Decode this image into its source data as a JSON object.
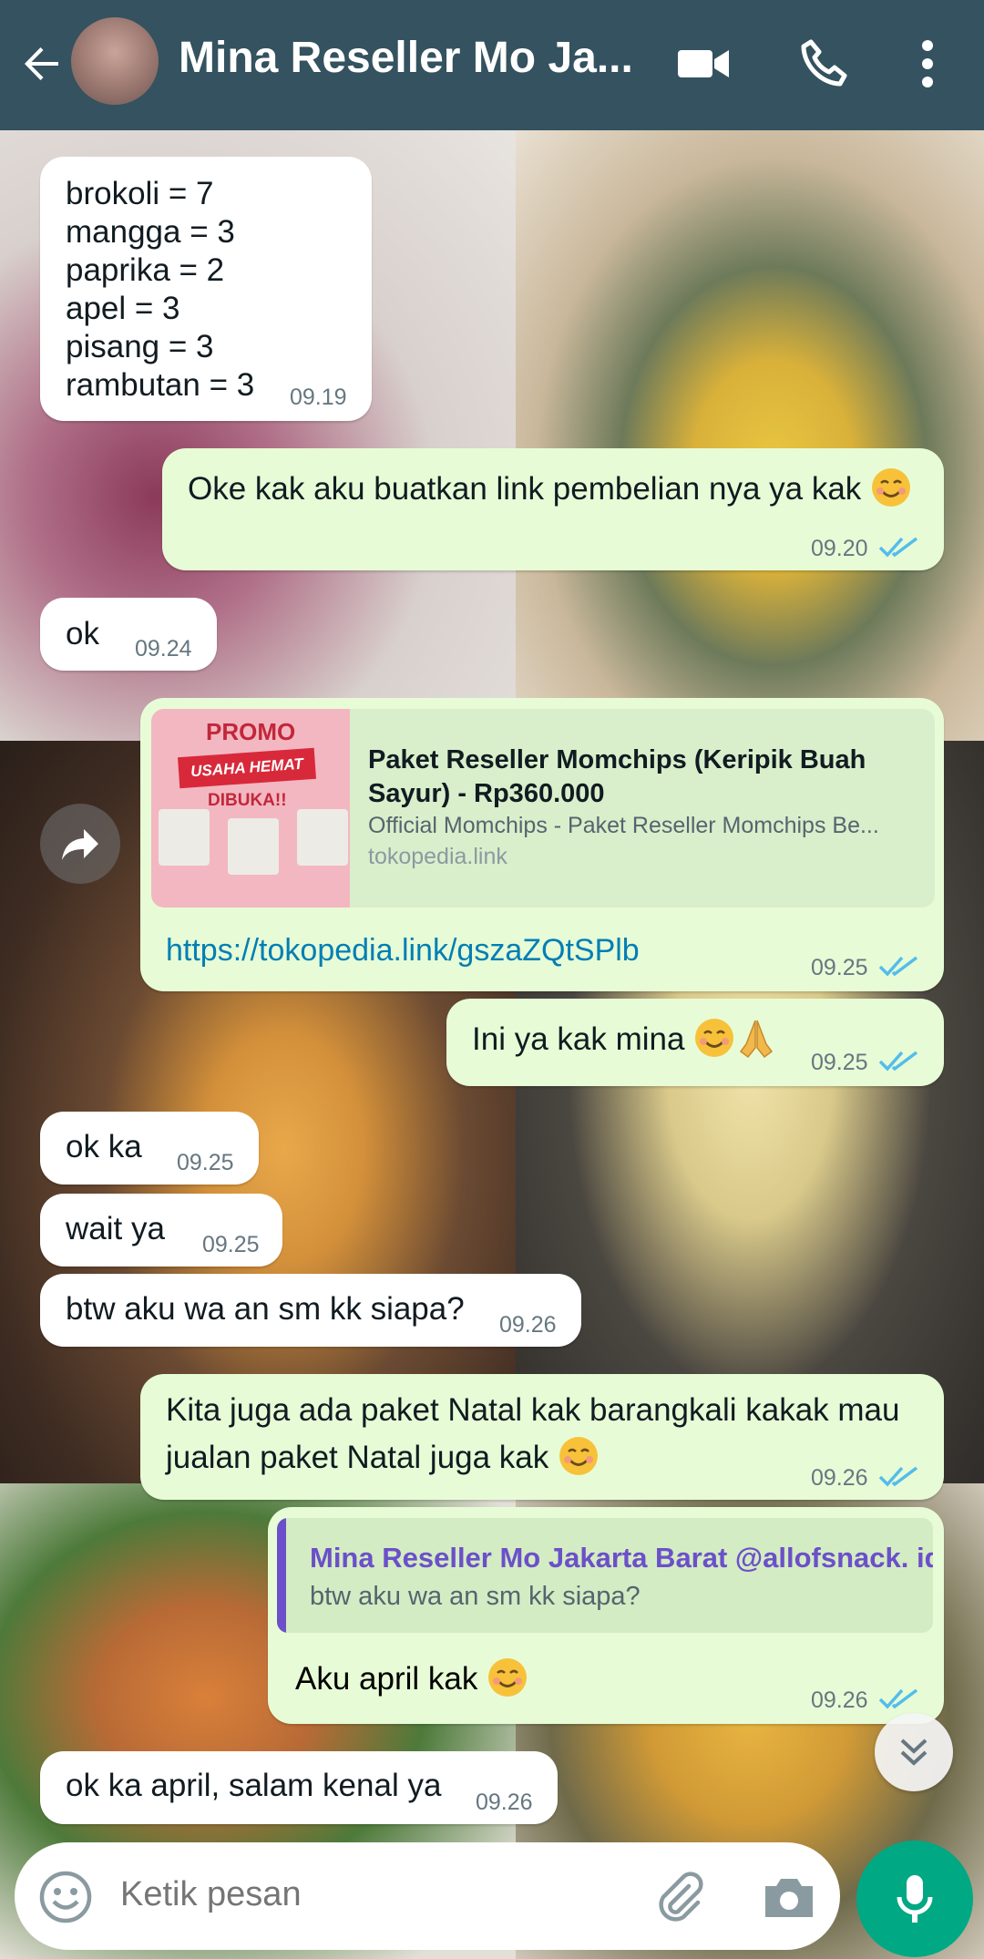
{
  "header": {
    "contact_name": "Mina Reseller Mo Ja...",
    "icons": [
      "arrow-back-icon",
      "video-call-icon",
      "phone-icon",
      "more-vert-icon"
    ]
  },
  "messages": [
    {
      "dir": "in",
      "lines": [
        "brokoli = 7",
        "mangga = 3",
        "paprika = 2",
        "apel = 3",
        "pisang = 3",
        "rambutan = 3"
      ],
      "time": "09.19"
    },
    {
      "dir": "out",
      "text": "Oke kak aku buatkan link pembelian nya ya kak",
      "emoji": "smiling-face-icon",
      "time": "09.20",
      "read": true
    },
    {
      "dir": "in",
      "text": "ok",
      "time": "09.24"
    },
    {
      "dir": "out",
      "preview": {
        "image_label_promo": "PROMO",
        "image_label_banner": "USAHA HEMAT",
        "image_label_open": "DIBUKA!!",
        "title": "Paket Reseller Momchips (Keripik Buah Sayur) - Rp360.000",
        "description": "Official Momchips - Paket Reseller Momchips Be...",
        "domain": "tokopedia.link"
      },
      "link": "https://tokopedia.link/gszaZQtSPlb",
      "time": "09.25",
      "read": true
    },
    {
      "dir": "out",
      "text": "Ini ya kak mina",
      "emoji": "smiling-face-and-folded-hands-icon",
      "time": "09.25",
      "read": true
    },
    {
      "dir": "in",
      "text": "ok ka",
      "time": "09.25"
    },
    {
      "dir": "in",
      "text": "wait ya",
      "time": "09.25"
    },
    {
      "dir": "in",
      "text": "btw aku wa an sm kk siapa?",
      "time": "09.26"
    },
    {
      "dir": "out",
      "lines": [
        "Kita juga ada paket Natal kak barangkali kakak mau",
        "jualan paket Natal juga kak"
      ],
      "emoji": "smiling-face-icon",
      "time": "09.26",
      "read": true
    },
    {
      "dir": "out",
      "quote": {
        "author": "Mina Reseller Mo Jakarta Barat @allofsnack. id",
        "text": "btw aku wa an sm kk siapa?"
      },
      "text": "Aku april kak",
      "emoji": "smiling-face-icon",
      "time": "09.26",
      "read": true
    },
    {
      "dir": "in",
      "text": "ok ka april, salam kenal ya",
      "time": "09.26"
    }
  ],
  "composer": {
    "placeholder": "Ketik pesan",
    "icons": [
      "emoji-icon",
      "attach-icon",
      "camera-icon",
      "mic-icon"
    ]
  },
  "colors": {
    "header": "#34525f",
    "outgoing_bubble": "#e7fcd6",
    "incoming_bubble": "#ffffff",
    "read_ticks": "#53bdeb",
    "link": "#027eb5",
    "mic_button": "#00a884",
    "quote_accent": "#6b50c9"
  }
}
